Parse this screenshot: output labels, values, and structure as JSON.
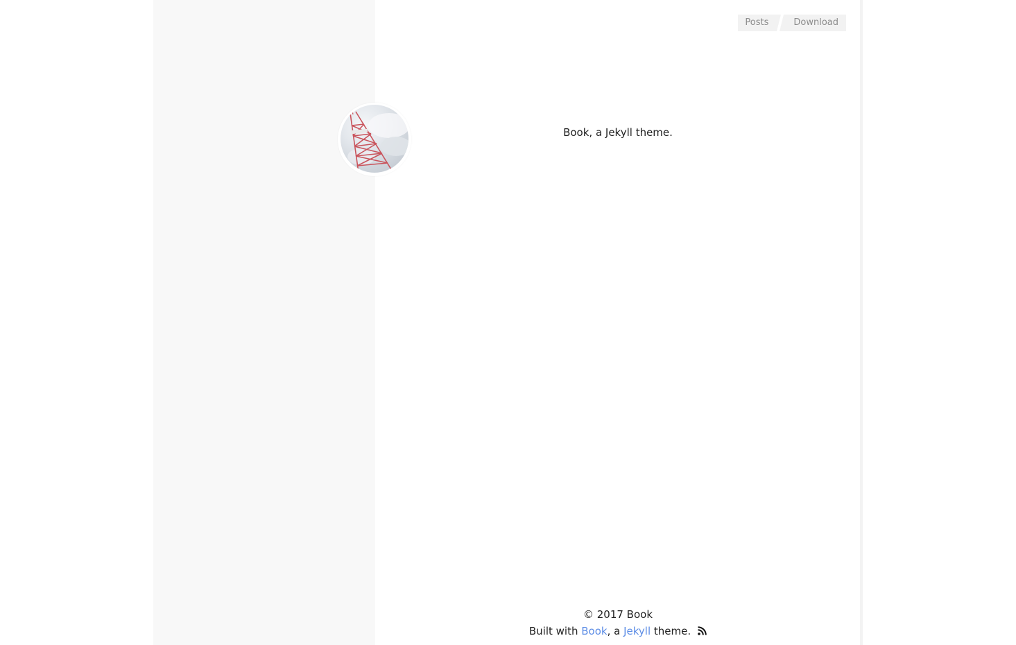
{
  "nav": {
    "items": [
      {
        "label": "Posts"
      },
      {
        "label": "Download"
      }
    ]
  },
  "avatar": {
    "icon": "tokyo-tower-photo"
  },
  "main": {
    "tagline": "Book, a Jekyll theme."
  },
  "footer": {
    "copyright": "© 2017 Book",
    "built_prefix": "Built with ",
    "book_link": "Book",
    "separator": ", a ",
    "jekyll_link": "Jekyll",
    "suffix": " theme.",
    "rss_icon": "rss-icon"
  },
  "colors": {
    "link": "#5e8ee6",
    "sidebar_bg": "#f8f8f8",
    "nav_bg": "#f2f2f2",
    "nav_text": "#8c8c8c"
  }
}
